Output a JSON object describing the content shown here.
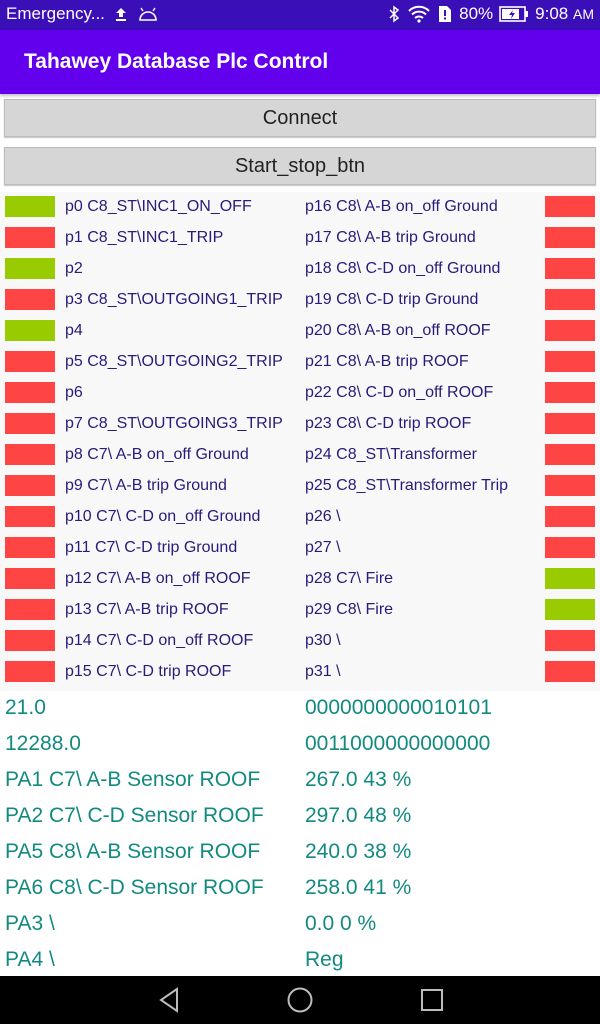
{
  "status_bar": {
    "notification": "Emergency...",
    "battery": "80%",
    "time": "9:08",
    "ampm": "AM",
    "icons": [
      "upload-icon",
      "android-icon",
      "bluetooth-icon",
      "wifi-icon",
      "sim-alert-icon",
      "battery-icon"
    ]
  },
  "app_bar": {
    "title": "Tahawey Database Plc Control"
  },
  "buttons": {
    "connect": "Connect",
    "start_stop": "Start_stop_btn"
  },
  "colors": {
    "on": "#99cc00",
    "off": "#ff4444"
  },
  "indicators": [
    {
      "label": "p0 C8_ST\\INC1_ON_OFF",
      "state": "on"
    },
    {
      "label": "p1 C8_ST\\INC1_TRIP",
      "state": "off"
    },
    {
      "label": "p2",
      "state": "on"
    },
    {
      "label": "p3 C8_ST\\OUTGOING1_TRIP",
      "state": "off"
    },
    {
      "label": "p4",
      "state": "on"
    },
    {
      "label": "p5 C8_ST\\OUTGOING2_TRIP",
      "state": "off"
    },
    {
      "label": "p6",
      "state": "off"
    },
    {
      "label": "p7 C8_ST\\OUTGOING3_TRIP",
      "state": "off"
    },
    {
      "label": "p8 C7\\  A-B on_off  Ground",
      "state": "off"
    },
    {
      "label": "p9 C7\\  A-B trip  Ground",
      "state": "off"
    },
    {
      "label": "p10 C7\\  C-D on_off  Ground",
      "state": "off"
    },
    {
      "label": "p11 C7\\  C-D trip  Ground",
      "state": "off"
    },
    {
      "label": "p12 C7\\  A-B on_off  ROOF",
      "state": "off"
    },
    {
      "label": "p13 C7\\  A-B trip  ROOF",
      "state": "off"
    },
    {
      "label": "p14 C7\\  C-D on_off  ROOF",
      "state": "off"
    },
    {
      "label": "p15 C7\\  C-D trip  ROOF",
      "state": "off"
    },
    {
      "label": "p16 C8\\  A-B on_off  Ground",
      "state": "off"
    },
    {
      "label": "p17 C8\\  A-B trip  Ground",
      "state": "off"
    },
    {
      "label": "p18 C8\\  C-D on_off  Ground",
      "state": "off"
    },
    {
      "label": "p19 C8\\  C-D trip  Ground",
      "state": "off"
    },
    {
      "label": "p20 C8\\  A-B on_off  ROOF",
      "state": "off"
    },
    {
      "label": "p21 C8\\  A-B trip  ROOF",
      "state": "off"
    },
    {
      "label": "p22 C8\\  C-D on_off  ROOF",
      "state": "off"
    },
    {
      "label": "p23 C8\\  C-D trip  ROOF",
      "state": "off"
    },
    {
      "label": "p24 C8_ST\\Transformer",
      "state": "off"
    },
    {
      "label": "p25 C8_ST\\Transformer Trip",
      "state": "off"
    },
    {
      "label": "p26 \\",
      "state": "off"
    },
    {
      "label": "p27 \\",
      "state": "off"
    },
    {
      "label": "p28 C7\\ Fire",
      "state": "on"
    },
    {
      "label": "p29 C8\\ Fire",
      "state": "on"
    },
    {
      "label": "p30 \\",
      "state": "off"
    },
    {
      "label": "p31 \\",
      "state": "off"
    }
  ],
  "values": [
    {
      "left": "21.0",
      "right": "0000000000010101"
    },
    {
      "left": "12288.0",
      "right": "0011000000000000"
    },
    {
      "left": "PA1 C7\\  A-B Sensor  ROOF",
      "right": "267.0  43 %"
    },
    {
      "left": "PA2 C7\\  C-D Sensor  ROOF",
      "right": "297.0  48 %"
    },
    {
      "left": "PA5 C8\\  A-B Sensor  ROOF",
      "right": "240.0  38 %"
    },
    {
      "left": "PA6 C8\\  C-D Sensor  ROOF",
      "right": "258.0  41 %"
    },
    {
      "left": "PA3 \\",
      "right": "0.0  0 %"
    },
    {
      "left": "PA4 \\",
      "right": "Reg"
    }
  ],
  "nav": {
    "back": "back-icon",
    "home": "home-icon",
    "recents": "recents-icon"
  }
}
